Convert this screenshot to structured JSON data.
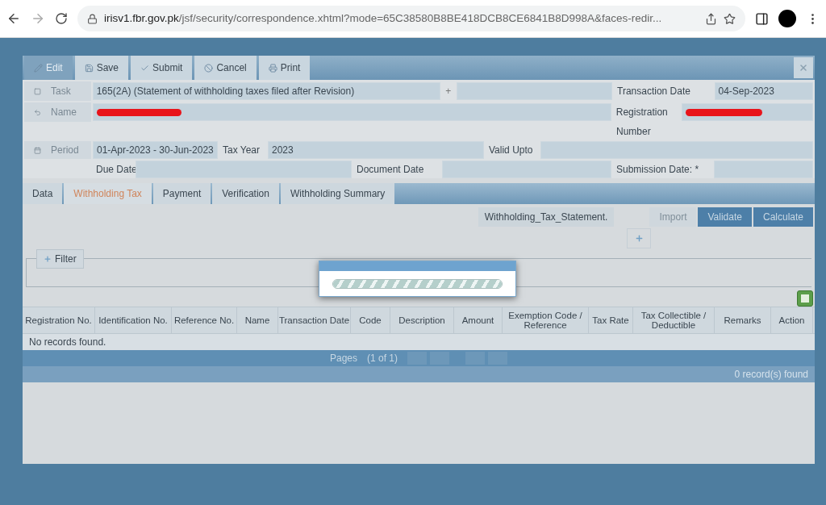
{
  "browser": {
    "url_host": "irisv1.fbr.gov.pk",
    "url_path": "/jsf/security/correspondence.xhtml?mode=65C38580B8BE418DCB8CE6841B8D998A&faces-redir..."
  },
  "toolbar": {
    "buttons": [
      {
        "label": "Edit",
        "kind": "edit",
        "disabled": true
      },
      {
        "label": "Save",
        "kind": "save",
        "disabled": false
      },
      {
        "label": "Submit",
        "kind": "submit",
        "disabled": false
      },
      {
        "label": "Cancel",
        "kind": "cancel",
        "disabled": false
      },
      {
        "label": "Print",
        "kind": "print",
        "disabled": false
      }
    ]
  },
  "form": {
    "task_label": "Task",
    "task_value": "165(2A) (Statement of withholding taxes filed after Revision)",
    "plus": "+",
    "transaction_date_label": "Transaction Date",
    "transaction_date": "04-Sep-2023",
    "name_label": "Name",
    "registration_label": "Registration",
    "registration_label_2": "Number",
    "period_label": "Period",
    "period_value": "01-Apr-2023 -  30-Jun-2023",
    "tax_year_label": "Tax Year",
    "tax_year": "2023",
    "valid_upto_label": "Valid Upto",
    "due_date_label": "Due Date",
    "document_date_label": "Document Date",
    "submission_date_label": "Submission Date: *"
  },
  "tabs": [
    {
      "label": "Data",
      "selected": false
    },
    {
      "label": "Withholding Tax",
      "selected": true
    },
    {
      "label": "Payment",
      "selected": false
    },
    {
      "label": "Verification",
      "selected": false
    },
    {
      "label": "Withholding Summary",
      "selected": false
    }
  ],
  "file_name": "Withholding_Tax_Statement.",
  "actions": [
    {
      "label": "Import",
      "disabled": true
    },
    {
      "label": "Validate",
      "disabled": false
    },
    {
      "label": "Calculate",
      "disabled": false
    }
  ],
  "filter_label": "Filter",
  "progress": {
    "level": 1
  },
  "table": {
    "columns": [
      "Registration No.",
      "Identification No.",
      "Reference No.",
      "Name",
      "Transaction Date",
      "Code",
      "Description",
      "Amount",
      "Exemption Code / Reference",
      "Tax Rate",
      "Tax Collectible / Deductible",
      "Remarks",
      "Action"
    ],
    "empty_message": "No records found."
  },
  "paginator": {
    "label": "Pages",
    "current": "(1 of 1)"
  },
  "record_count": "0 record(s) found"
}
